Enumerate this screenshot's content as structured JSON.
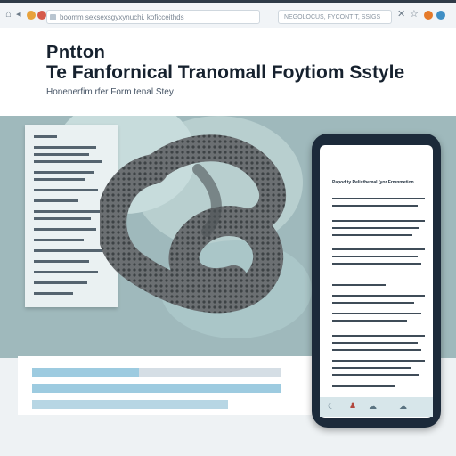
{
  "browser": {
    "address_text": "boomm sexsexsgyxynuchi, koficceithds",
    "search_text": "NEGOLOCUS, FYCONTIT, SSIGS"
  },
  "header": {
    "title_line1": "Pntton",
    "title_line2": "Te Fanfornical Tranomall Foytiom Sstyle",
    "subtitle": "Honenerfim rfer Form tenal Stey"
  },
  "phone": {
    "heading": "Papod ty Relisthemal (yor Frmnmetion"
  },
  "colors": {
    "stage": "#9fb9bc",
    "bar_blue": "#9dcbe0",
    "bar_grey": "#d5dee5",
    "phone_body": "#1c2a3a"
  },
  "icons": [
    "home-icon",
    "back-icon",
    "lock-icon",
    "star-icon",
    "fox-browser-icon",
    "shield-icon",
    "snake-illustration",
    "person-icon"
  ]
}
